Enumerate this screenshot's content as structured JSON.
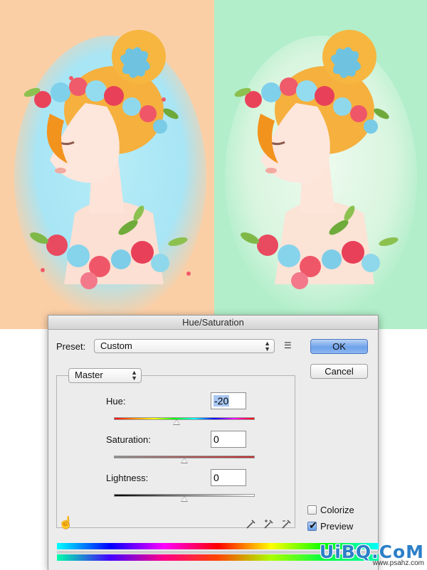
{
  "dialog": {
    "title": "Hue/Saturation",
    "preset_label": "Preset:",
    "preset_value": "Custom",
    "ok_label": "OK",
    "cancel_label": "Cancel",
    "channel_value": "Master",
    "hue_label": "Hue:",
    "hue_value": "-20",
    "saturation_label": "Saturation:",
    "saturation_value": "0",
    "lightness_label": "Lightness:",
    "lightness_value": "0",
    "colorize_label": "Colorize",
    "colorize_checked": false,
    "preview_label": "Preview",
    "preview_checked": true
  },
  "sliders": {
    "hue": {
      "value": -20,
      "min": -180,
      "max": 180
    },
    "saturation": {
      "value": 0,
      "min": -100,
      "max": 100
    },
    "lightness": {
      "value": 0,
      "min": -100,
      "max": 100
    }
  },
  "icons": {
    "preset_menu": "list-menu-icon",
    "targeted_adjustment": "hand-scrubby-icon",
    "eyedropper": "eyedropper-icon",
    "eyedropper_add": "eyedropper-plus-icon",
    "eyedropper_subtract": "eyedropper-minus-icon"
  },
  "colors": {
    "left_background": "#fbcfa6",
    "left_glow": "#a8e5f5",
    "right_background": "#b1eec9",
    "right_glow": "#eaf9ec",
    "hair": "#f6b33f",
    "ok_button": "#6da1ea"
  },
  "watermark": {
    "brand": "UiBQ.CoM",
    "url": "www.psahz.com"
  }
}
